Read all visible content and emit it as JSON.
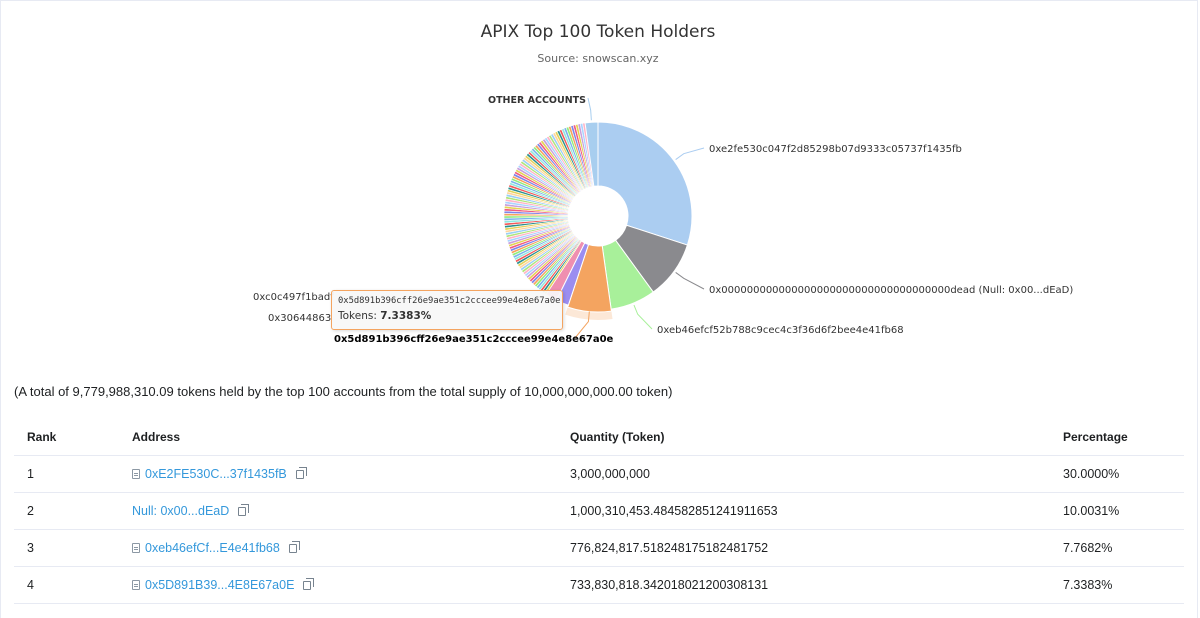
{
  "chart_data": {
    "type": "pie",
    "title": "APIX Top 100 Token Holders",
    "subtitle": "Source: snowscan.xyz",
    "donut": true,
    "slices": [
      {
        "label": "0xe2fe530c047f2d85298b07d9333c05737f1435fb",
        "value": 30.0,
        "color": "#abcdf1"
      },
      {
        "label": "0x000000000000000000000000000000000000dead (Null: 0x00...dEaD)",
        "value": 10.0031,
        "color": "#8a8a8e"
      },
      {
        "label": "0xeb46efcf52b788c9cec4c3f36d6f2bee4e41fb68",
        "value": 7.7682,
        "color": "#a8f09a"
      },
      {
        "label": "0x5d891b396cff26e9ae351c2cccee99e4e8e67a0e",
        "value": 7.3383,
        "color": "#f4a460"
      },
      {
        "label": "0x30644863",
        "value": 2.2,
        "color": "#9b8df0"
      },
      {
        "label": "0xc0c497f1badf",
        "value": 2.0,
        "color": "#ef8fb0"
      },
      {
        "label": "OTHER ACCOUNTS",
        "value": 2.2,
        "color": "#a8ceef"
      }
    ],
    "small_slice_percent_total": 38.49,
    "small_slice_colors": [
      "#e4d45c",
      "#2b908f",
      "#f45b5b",
      "#91e8e1",
      "#7cb5ec",
      "#90ed7d",
      "#f7a35c",
      "#8085e9",
      "#f15c80",
      "#e4d354",
      "#c9a0dc",
      "#aad4ff",
      "#ffb3c6",
      "#b0e57c",
      "#9ad0f5",
      "#ffd59e"
    ],
    "small_slice_count": 93
  },
  "tooltip": {
    "address": "0x5d891b396cff26e9ae351c2cccee99e4e8e67a0e",
    "label": "Tokens:",
    "value": "7.3383%"
  },
  "summary": "(A total of 9,779,988,310.09 tokens held by the top 100 accounts from the total supply of 10,000,000,000.00 token)",
  "table": {
    "headers": {
      "rank": "Rank",
      "address": "Address",
      "quantity": "Quantity (Token)",
      "percentage": "Percentage"
    },
    "rows": [
      {
        "rank": "1",
        "address": "0xE2FE530C...37f1435fB",
        "is_contract": true,
        "quantity": "3,000,000,000",
        "percentage": "30.0000%"
      },
      {
        "rank": "2",
        "address": "Null: 0x00...dEaD",
        "is_contract": false,
        "quantity": "1,000,310,453.484582851241911653",
        "percentage": "10.0031%"
      },
      {
        "rank": "3",
        "address": "0xeb46efCf...E4e41fb68",
        "is_contract": true,
        "quantity": "776,824,817.518248175182481752",
        "percentage": "7.7682%"
      },
      {
        "rank": "4",
        "address": "0x5D891B39...4E8E67a0E",
        "is_contract": true,
        "quantity": "733,830,818.342018021200308131",
        "percentage": "7.3383%"
      }
    ]
  }
}
